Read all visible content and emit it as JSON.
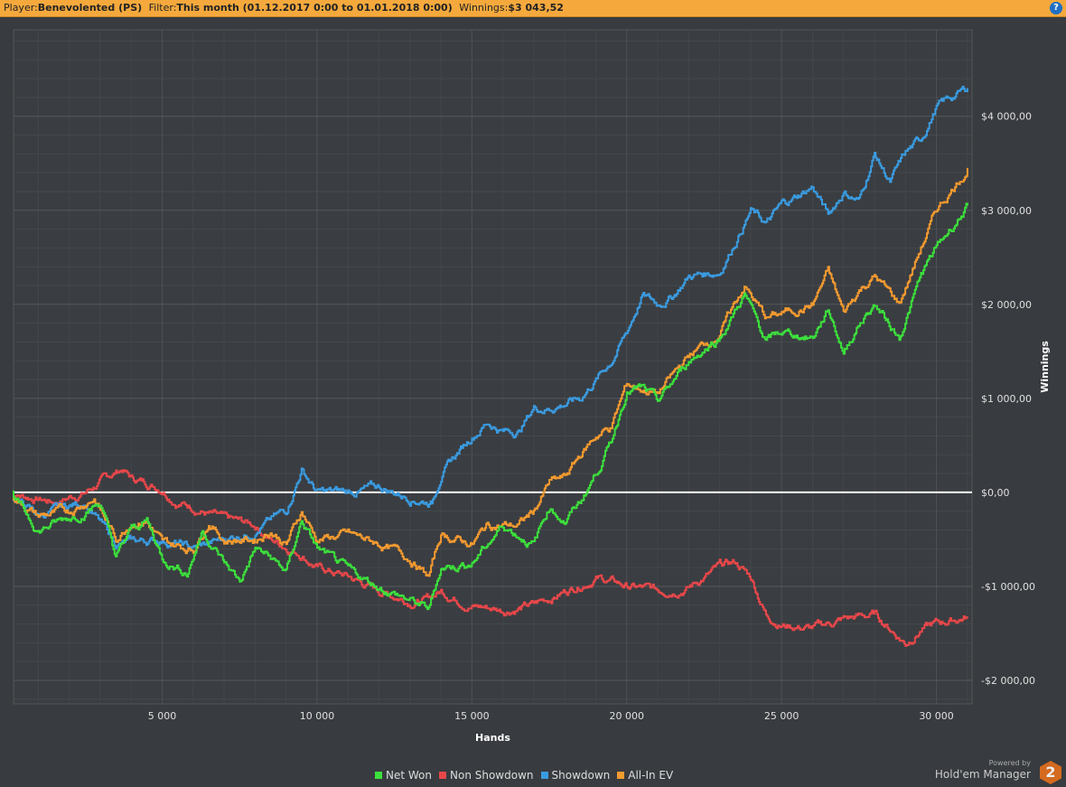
{
  "header": {
    "player_label": "Player:",
    "player": "Benevolented (PS)",
    "filter_label": "Filter:",
    "filter": "This month (01.12.2017 0:00 to 01.01.2018 0:00)",
    "winnings_label": "Winnings:",
    "winnings": "$3 043,52",
    "help": "?"
  },
  "branding": {
    "powered": "Powered by",
    "name": "Hold'em Manager",
    "logo": "2"
  },
  "chart_data": {
    "type": "line",
    "xlabel": "Hands",
    "ylabel": "Winnings",
    "xlim": [
      200,
      31150
    ],
    "ylim": [
      -2250,
      4920
    ],
    "xticks": [
      5000,
      10000,
      15000,
      20000,
      25000,
      30000
    ],
    "xtick_labels": [
      "5 000",
      "10 000",
      "15 000",
      "20 000",
      "25 000",
      "30 000"
    ],
    "yticks": [
      -2000,
      -1000,
      0,
      1000,
      2000,
      3000,
      4000
    ],
    "ytick_labels": [
      "-$2 000,00",
      "-$1 000,00",
      "$0,00",
      "$1 000,00",
      "$2 000,00",
      "$3 000,00",
      "$4 000,00"
    ],
    "grid": true,
    "legend": "bottom",
    "series": [
      {
        "name": "Non Showdown",
        "color": "#e8474a",
        "points": [
          [
            0,
            0
          ],
          [
            1500,
            -100
          ],
          [
            2500,
            0
          ],
          [
            3200,
            150
          ],
          [
            3700,
            250
          ],
          [
            4000,
            150
          ],
          [
            5000,
            50
          ],
          [
            5500,
            -100
          ],
          [
            6000,
            -150
          ],
          [
            7000,
            -300
          ],
          [
            8000,
            -350
          ],
          [
            8500,
            -500
          ],
          [
            9500,
            -650
          ],
          [
            10000,
            -800
          ],
          [
            11000,
            -900
          ],
          [
            12000,
            -1050
          ],
          [
            13000,
            -1150
          ],
          [
            13500,
            -1150
          ],
          [
            14000,
            -1050
          ],
          [
            15000,
            -1200
          ],
          [
            16000,
            -1250
          ],
          [
            17000,
            -1200
          ],
          [
            18000,
            -1050
          ],
          [
            19000,
            -900
          ],
          [
            20000,
            -1000
          ],
          [
            21000,
            -1050
          ],
          [
            22000,
            -1000
          ],
          [
            23000,
            -800
          ],
          [
            23500,
            -750
          ],
          [
            24000,
            -900
          ],
          [
            24500,
            -1300
          ],
          [
            25000,
            -1400
          ],
          [
            26000,
            -1450
          ],
          [
            27000,
            -1350
          ],
          [
            28000,
            -1300
          ],
          [
            28500,
            -1450
          ],
          [
            29000,
            -1600
          ],
          [
            29500,
            -1450
          ],
          [
            30000,
            -1400
          ],
          [
            31000,
            -1320
          ]
        ]
      },
      {
        "name": "Showdown",
        "color": "#3a9be0",
        "points": [
          [
            0,
            0
          ],
          [
            1000,
            -250
          ],
          [
            2500,
            -100
          ],
          [
            3500,
            -550
          ],
          [
            5000,
            -500
          ],
          [
            6000,
            -600
          ],
          [
            7000,
            -500
          ],
          [
            8000,
            -400
          ],
          [
            9000,
            -200
          ],
          [
            9500,
            250
          ],
          [
            10000,
            0
          ],
          [
            11000,
            0
          ],
          [
            12000,
            50
          ],
          [
            13000,
            -50
          ],
          [
            13700,
            -100
          ],
          [
            14000,
            200
          ],
          [
            15000,
            600
          ],
          [
            15500,
            750
          ],
          [
            16000,
            650
          ],
          [
            16500,
            650
          ],
          [
            17000,
            900
          ],
          [
            17500,
            900
          ],
          [
            18000,
            950
          ],
          [
            18500,
            1000
          ],
          [
            19000,
            1200
          ],
          [
            19500,
            1400
          ],
          [
            20000,
            1700
          ],
          [
            20500,
            2100
          ],
          [
            21000,
            2000
          ],
          [
            21500,
            2100
          ],
          [
            22000,
            2300
          ],
          [
            23000,
            2350
          ],
          [
            24000,
            3000
          ],
          [
            24500,
            2850
          ],
          [
            25000,
            3050
          ],
          [
            26000,
            3250
          ],
          [
            26500,
            2950
          ],
          [
            27000,
            3200
          ],
          [
            27500,
            3100
          ],
          [
            28000,
            3600
          ],
          [
            28500,
            3300
          ],
          [
            29000,
            3600
          ],
          [
            29500,
            3750
          ],
          [
            30000,
            4100
          ],
          [
            31000,
            4300
          ]
        ]
      },
      {
        "name": "All-In EV",
        "color": "#f39a30",
        "points": [
          [
            0,
            0
          ],
          [
            1000,
            -250
          ],
          [
            2000,
            -200
          ],
          [
            2800,
            -50
          ],
          [
            3500,
            -500
          ],
          [
            4000,
            -300
          ],
          [
            4500,
            -300
          ],
          [
            5000,
            -550
          ],
          [
            6000,
            -600
          ],
          [
            6500,
            -300
          ],
          [
            7000,
            -500
          ],
          [
            8000,
            -500
          ],
          [
            8500,
            -400
          ],
          [
            9000,
            -550
          ],
          [
            9500,
            -200
          ],
          [
            10000,
            -500
          ],
          [
            11000,
            -450
          ],
          [
            12000,
            -550
          ],
          [
            13000,
            -700
          ],
          [
            13600,
            -900
          ],
          [
            14000,
            -450
          ],
          [
            15000,
            -550
          ],
          [
            15500,
            -350
          ],
          [
            16500,
            -350
          ],
          [
            17000,
            -200
          ],
          [
            17500,
            100
          ],
          [
            18000,
            150
          ],
          [
            18500,
            400
          ],
          [
            19000,
            600
          ],
          [
            19500,
            700
          ],
          [
            20000,
            1150
          ],
          [
            21000,
            1050
          ],
          [
            22000,
            1450
          ],
          [
            23000,
            1700
          ],
          [
            23800,
            2200
          ],
          [
            24500,
            1850
          ],
          [
            25000,
            1900
          ],
          [
            26000,
            2000
          ],
          [
            26500,
            2350
          ],
          [
            27000,
            1900
          ],
          [
            27500,
            2150
          ],
          [
            28000,
            2300
          ],
          [
            28800,
            2000
          ],
          [
            29500,
            2600
          ],
          [
            30000,
            3000
          ],
          [
            31000,
            3450
          ]
        ]
      },
      {
        "name": "Net Won",
        "color": "#3ce03c",
        "points": [
          [
            0,
            0
          ],
          [
            1000,
            -400
          ],
          [
            2500,
            -200
          ],
          [
            3000,
            -100
          ],
          [
            3500,
            -700
          ],
          [
            4000,
            -400
          ],
          [
            4500,
            -300
          ],
          [
            5000,
            -700
          ],
          [
            5800,
            -850
          ],
          [
            6300,
            -400
          ],
          [
            7000,
            -750
          ],
          [
            7500,
            -950
          ],
          [
            8000,
            -600
          ],
          [
            8500,
            -700
          ],
          [
            9000,
            -850
          ],
          [
            9500,
            -300
          ],
          [
            10000,
            -600
          ],
          [
            11000,
            -850
          ],
          [
            12000,
            -1000
          ],
          [
            13000,
            -1150
          ],
          [
            13600,
            -1250
          ],
          [
            14000,
            -800
          ],
          [
            15000,
            -750
          ],
          [
            16000,
            -350
          ],
          [
            17000,
            -550
          ],
          [
            17500,
            -150
          ],
          [
            18000,
            -300
          ],
          [
            18500,
            -100
          ],
          [
            19000,
            200
          ],
          [
            19500,
            550
          ],
          [
            20000,
            1100
          ],
          [
            20500,
            1100
          ],
          [
            21000,
            950
          ],
          [
            22000,
            1400
          ],
          [
            23000,
            1650
          ],
          [
            23800,
            2100
          ],
          [
            24500,
            1600
          ],
          [
            25000,
            1700
          ],
          [
            26000,
            1650
          ],
          [
            26500,
            1950
          ],
          [
            27000,
            1500
          ],
          [
            27500,
            1800
          ],
          [
            28000,
            2000
          ],
          [
            28800,
            1650
          ],
          [
            29500,
            2300
          ],
          [
            30000,
            2600
          ],
          [
            31000,
            3050
          ]
        ]
      }
    ],
    "legend_order": [
      "Net Won",
      "Non Showdown",
      "Showdown",
      "All-In EV"
    ]
  }
}
